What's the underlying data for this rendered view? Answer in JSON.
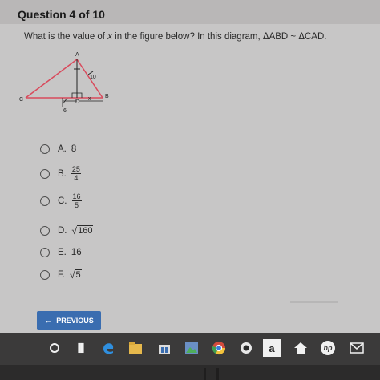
{
  "header": {
    "title": "Question 4 of 10"
  },
  "question": {
    "text_prefix": "What is the value of ",
    "variable": "x",
    "text_suffix": " in the figure below? In this diagram, ΔABD ~ ΔCAD."
  },
  "diagram": {
    "labels": {
      "A": "A",
      "B": "B",
      "C": "C",
      "D": "D",
      "x": "x",
      "ten": "10",
      "six": "6"
    },
    "colors": {
      "triangle": "#d94a5c",
      "lines": "#222222"
    }
  },
  "options": [
    {
      "letter": "A.",
      "value": "8"
    },
    {
      "letter": "B.",
      "num": "25",
      "den": "4"
    },
    {
      "letter": "C.",
      "num": "16",
      "den": "5"
    },
    {
      "letter": "D.",
      "sqrt": "160"
    },
    {
      "letter": "E.",
      "value": "16"
    },
    {
      "letter": "F.",
      "sqrt": "5"
    }
  ],
  "buttons": {
    "previous": "PREVIOUS"
  },
  "taskbar": {
    "icons": [
      "cortana-circle-icon",
      "task-view-icon",
      "edge-icon",
      "file-explorer-icon",
      "store-icon",
      "photos-icon",
      "chrome-icon",
      "camera-icon",
      "amazon-icon",
      "home-icon",
      "hp-icon",
      "mail-icon"
    ],
    "amazon_label": "a",
    "hp_label": "hp",
    "taskview_label": "▐▌"
  },
  "colors": {
    "accent": "#3a6db0",
    "background": "#c7c6c6",
    "taskbar": "#3b3a3a"
  }
}
